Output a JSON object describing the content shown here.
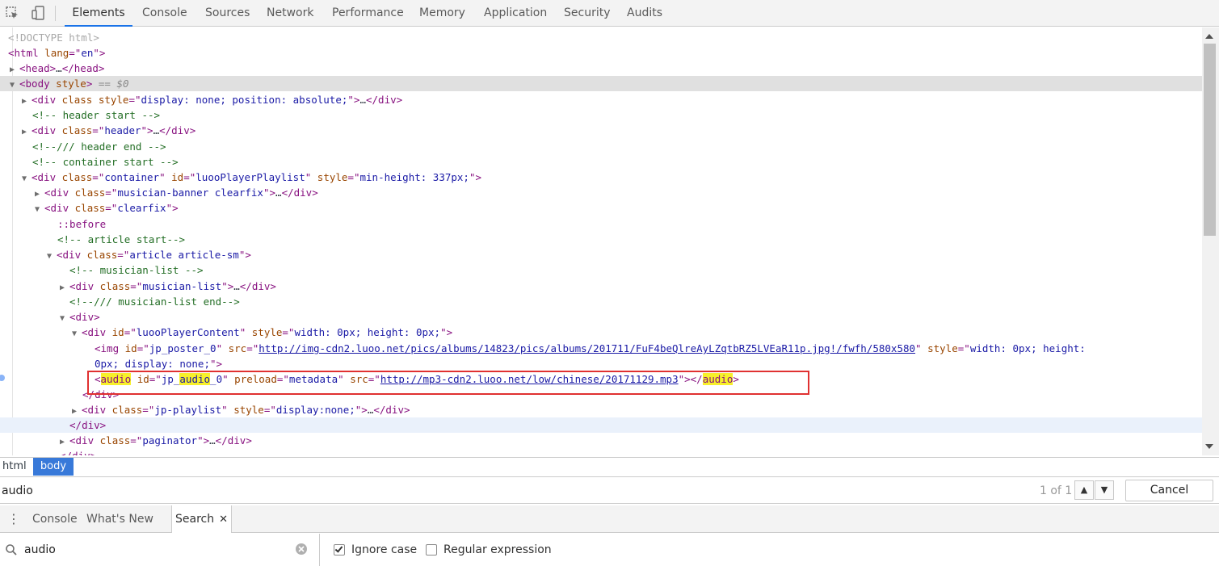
{
  "toolbar": {
    "inspect_icon": "inspect-element-icon",
    "device_icon": "device-toolbar-icon",
    "tabs": [
      "Elements",
      "Console",
      "Sources",
      "Network",
      "Performance",
      "Memory",
      "Application",
      "Security",
      "Audits"
    ],
    "selected_tab": "Elements"
  },
  "tree": {
    "rows": [
      {
        "id": "doctype",
        "text": "<!DOCTYPE html>"
      },
      {
        "id": "html-open",
        "tag": "html",
        "attr": "lang",
        "val": "en"
      },
      {
        "id": "head",
        "tag": "head",
        "ellipsis": "…",
        "close": "head"
      },
      {
        "id": "body",
        "tag": "body",
        "attr": "style",
        "marker": "== $0"
      },
      {
        "id": "div-hidden",
        "tag": "div",
        "attr1": "class",
        "attr2": "style",
        "val2": "display: none; position: absolute;",
        "ellipsis": "…",
        "close": "div"
      },
      {
        "id": "cm-header-start",
        "comment": "<!-- header start -->"
      },
      {
        "id": "div-header",
        "tag": "div",
        "attr": "class",
        "val": "header",
        "ellipsis": "…",
        "close": "div"
      },
      {
        "id": "cm-header-end",
        "comment": "<!--/// header end -->"
      },
      {
        "id": "cm-container-start",
        "comment": "<!-- container start -->"
      },
      {
        "id": "div-container",
        "tag": "div",
        "attr1": "class",
        "val1": "container",
        "attr2": "id",
        "val2": "luooPlayerPlaylist",
        "attr3": "style",
        "val3": "min-height: 337px;"
      },
      {
        "id": "div-banner",
        "tag": "div",
        "attr": "class",
        "val": "musician-banner clearfix",
        "ellipsis": "…",
        "close": "div"
      },
      {
        "id": "div-clearfix",
        "tag": "div",
        "attr": "class",
        "val": "clearfix"
      },
      {
        "id": "pseudo-before",
        "pseudo": "::before"
      },
      {
        "id": "cm-article-start",
        "comment": "<!-- article start-->"
      },
      {
        "id": "div-article",
        "tag": "div",
        "attr": "class",
        "val": "article article-sm"
      },
      {
        "id": "cm-musician-list",
        "comment": "<!-- musician-list -->"
      },
      {
        "id": "div-musician-list",
        "tag": "div",
        "attr": "class",
        "val": "musician-list",
        "ellipsis": "…",
        "close": "div"
      },
      {
        "id": "cm-musician-list-end",
        "comment": "<!--/// musician-list end-->"
      },
      {
        "id": "div-plain",
        "tag": "div"
      },
      {
        "id": "div-player-content",
        "tag": "div",
        "attr1": "id",
        "val1": "luooPlayerContent",
        "attr2": "style",
        "val2": "width: 0px; height: 0px;"
      },
      {
        "id": "img-poster",
        "tag": "img",
        "attr1": "id",
        "val1": "jp_poster_0",
        "attr2": "src",
        "link": "http://img-cdn2.luoo.net/pics/albums/14823/pics/albums/201711/FuF4beQlreAyLZqtbRZ5LVEaR11p.jpg!/fwfh/580x580",
        "attr3": "style",
        "val3a": "width: 0px; height:",
        "val3b": "0px; display: none;"
      },
      {
        "id": "audio",
        "tag": "audio",
        "attr1": "id",
        "val1a": "jp_",
        "val1b": "audio",
        "val1c": "_0",
        "attr2": "preload",
        "val2": "metadata",
        "attr3": "src",
        "link": "http://mp3-cdn2.luoo.net/low/chinese/20171129.mp3",
        "close": "audio"
      },
      {
        "id": "div-close-1",
        "close": "div"
      },
      {
        "id": "div-playlist",
        "tag": "div",
        "attr1": "class",
        "val1": "jp-playlist",
        "attr2": "style",
        "val2": "display:none;",
        "ellipsis": "…",
        "close": "div"
      },
      {
        "id": "div-close-2",
        "close": "div"
      },
      {
        "id": "div-paginator",
        "tag": "div",
        "attr": "class",
        "val": "paginator",
        "ellipsis": "…",
        "close": "div"
      },
      {
        "id": "div-close-3",
        "close": "div"
      }
    ]
  },
  "breadcrumbs": [
    "html",
    "body"
  ],
  "findbar": {
    "query": "audio",
    "count": "1 of 1",
    "cancel_label": "Cancel"
  },
  "drawer": {
    "tabs": [
      "Console",
      "What's New",
      "Search"
    ],
    "active_tab": "Search",
    "close_glyph": "✕"
  },
  "search": {
    "query": "audio",
    "ignore_case_label": "Ignore case",
    "ignore_case_checked": true,
    "regex_label": "Regular expression",
    "regex_checked": false
  }
}
